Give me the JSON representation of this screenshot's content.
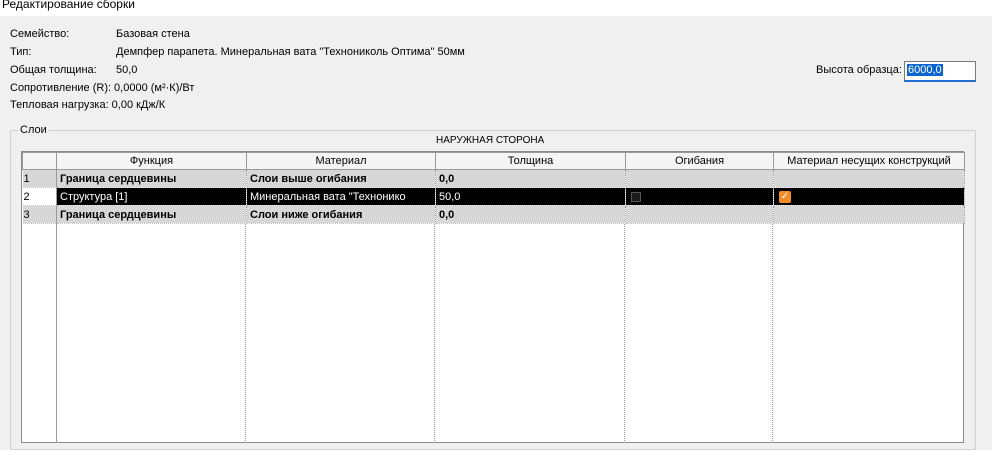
{
  "window": {
    "title": "Редактирование сборки"
  },
  "properties": {
    "family_label": "Семейство:",
    "family_value": "Базовая стена",
    "type_label": "Тип:",
    "type_value": "Демпфер парапета. Минеральная вата \"Технониколь Оптима\" 50мм",
    "thickness_label": "Общая толщина:",
    "thickness_value": "50,0",
    "resistance_label": "Сопротивление (R):",
    "resistance_value": "0,0000 (м²·К)/Вт",
    "thermal_label": "Тепловая нагрузка:",
    "thermal_value": "0,00 кДж/К"
  },
  "sample_height": {
    "label": "Высота образца:",
    "value": "6000,0"
  },
  "layers": {
    "group_label": "Слои",
    "outer_side": "НАРУЖНАЯ СТОРОНА",
    "columns": [
      "Функция",
      "Материал",
      "Толщина",
      "Огибания",
      "Материал несущих конструкций"
    ],
    "rows": [
      {
        "num": "1",
        "function": "Граница сердцевины",
        "material": "Слои выше огибания",
        "thickness": "0,0",
        "wraps": "",
        "structural": ""
      },
      {
        "num": "2",
        "function": "Структура [1]",
        "material": "Минеральная вата \"Технонико",
        "thickness": "50,0",
        "wraps": "unchecked",
        "structural": "checked"
      },
      {
        "num": "3",
        "function": "Граница сердцевины",
        "material": "Слои ниже огибания",
        "thickness": "0,0",
        "wraps": "",
        "structural": ""
      }
    ]
  }
}
